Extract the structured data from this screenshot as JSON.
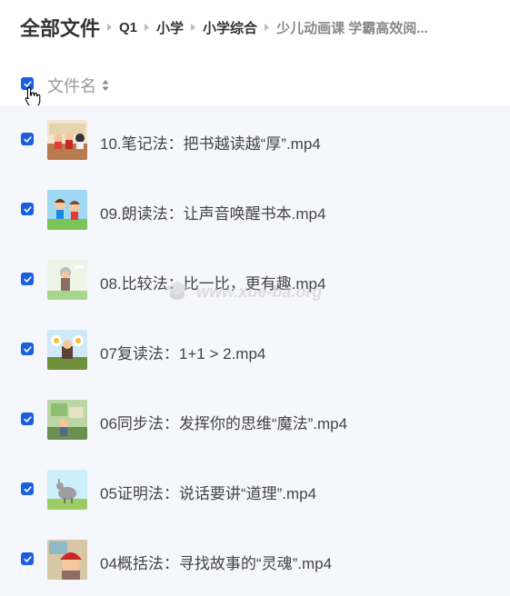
{
  "breadcrumb": {
    "root": "全部文件",
    "items": [
      "Q1",
      "小学",
      "小学综合",
      "少儿动画课 学霸高效阅..."
    ]
  },
  "header": {
    "column_name": "文件名"
  },
  "files": [
    {
      "name": "10.笔记法：把书越读越“厚”.mp4",
      "thumb": "classroom-thumbnail"
    },
    {
      "name": "09.朗读法：让声音唤醒书本.mp4",
      "thumb": "kids-running-thumbnail"
    },
    {
      "name": "08.比较法：比一比，更有趣.mp4",
      "thumb": "grandma-thumbnail"
    },
    {
      "name": "07复读法：1+1 > 2.mp4",
      "thumb": "flowers-thumbnail"
    },
    {
      "name": "06同步法：发挥你的思维“魔法”.mp4",
      "thumb": "forest-thumbnail"
    },
    {
      "name": "05证明法：说话要讲“道理”.mp4",
      "thumb": "donkey-thumbnail"
    },
    {
      "name": "04概括法：寻找故事的“灵魂”.mp4",
      "thumb": "storyteller-thumbnail"
    }
  ],
  "watermark": {
    "text": "www.xue-ba.org"
  },
  "colors": {
    "accent": "#1b5fe0",
    "list_bg": "#f6f7fc"
  }
}
